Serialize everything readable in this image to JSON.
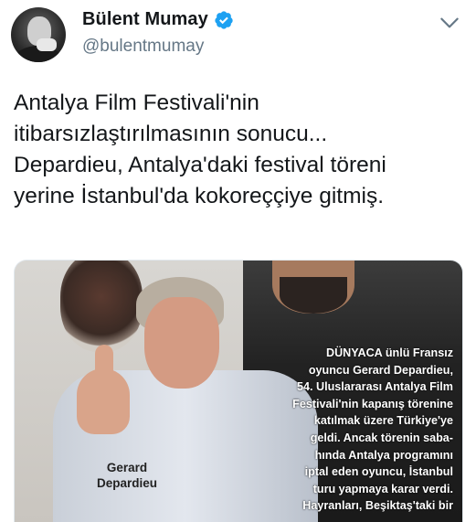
{
  "user": {
    "display_name": "Bülent Mumay",
    "handle": "@bulentmumay",
    "verified": true,
    "verified_color": "#1da1f2",
    "avatar_icon": "avatar-photo"
  },
  "tweet": {
    "text": "Antalya Film Festivali'nin\nitibarsızlaştırılmasının sonucu...\nDepardieu, Antalya'daki festival töreni\nyerine İstanbul'da kokoreççiye gitmiş."
  },
  "media": {
    "caption_lines": [
      "Gerard",
      "Depardieu"
    ],
    "article_lead": "DÜNYACA",
    "article_lines": [
      "ünlü Fransız",
      "oyuncu Gerard Depardieu,",
      "54. Uluslararası Antalya Film",
      "Festivali'nin kapanış törenine",
      "katılmak üzere Türkiye'ye",
      "geldi. Ancak törenin saba-",
      "hında Antalya programını",
      "iptal eden oyuncu, İstanbul",
      "turu yapmaya karar verdi.",
      "Hayranları, Beşiktaş'taki bir"
    ]
  },
  "icons": {
    "menu": "chevron-down-icon",
    "verified": "verified-badge-icon"
  },
  "colors": {
    "text": "#14171a",
    "secondary": "#657786",
    "accent": "#1da1f2"
  }
}
